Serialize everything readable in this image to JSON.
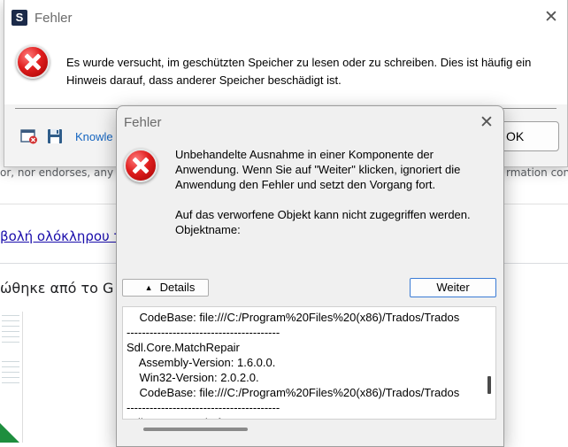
{
  "background_page": {
    "footer_text_left": "or, nor endorses, any op",
    "footer_text_right": "rmation contai",
    "link_text": "βολή ολόκληρου το",
    "heading_text": "ώθηκε από το G"
  },
  "back_dialog": {
    "title": "Fehler",
    "app_icon_letter": "S",
    "close_label": "✕",
    "message": "Es wurde versucht, im geschützten Speicher zu lesen oder zu schreiben. Dies ist häufig ein Hinweis darauf, dass anderer Speicher beschädigt ist.",
    "knowledge_link": "Knowle",
    "ok_label": "OK"
  },
  "front_dialog": {
    "title": "Fehler",
    "close_label": "✕",
    "message_lines": [
      "Unbehandelte Ausnahme in einer Komponente der Anwendung. Wenn Sie auf \"Weiter\" klicken, ignoriert die Anwendung den Fehler und setzt den Vorgang fort.",
      "Auf das verworfene Objekt kann nicht zugegriffen werden.",
      "Objektname:"
    ],
    "details_label": "Details",
    "details_arrow": "▲",
    "weiter_label": "Weiter",
    "details_text": "    CodeBase: file:///C:/Program%20Files%20(x86)/Trados/Trados\n----------------------------------------\nSdl.Core.MatchRepair\n    Assembly-Version: 1.6.0.0.\n    Win32-Version: 2.0.2.0.\n    CodeBase: file:///C:/Program%20Files%20(x86)/Trados/Trados\n----------------------------------------\nSdl.LanguagePlatform.Stat"
  },
  "icons": {
    "error": "error-circle-x-icon",
    "window_close": "window-close-icon",
    "save": "floppy-disk-icon"
  },
  "colors": {
    "error_red": "#e01f1f",
    "link_blue": "#1565c0",
    "focus_border": "#3a7bd5"
  }
}
